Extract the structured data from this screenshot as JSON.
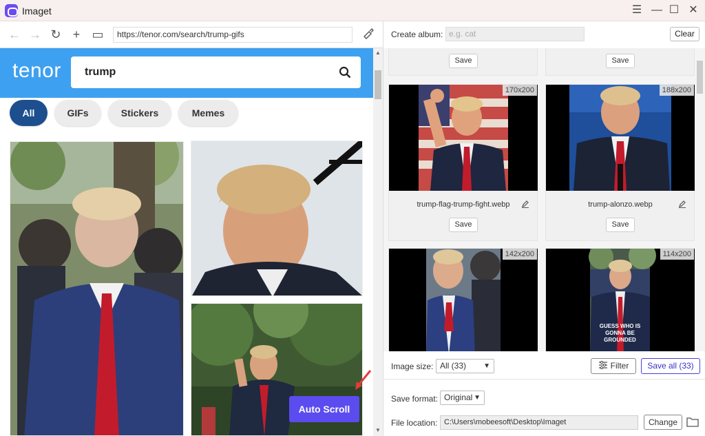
{
  "window": {
    "title": "Imaget"
  },
  "browser": {
    "url": "https://tenor.com/search/trump-gifs"
  },
  "tenor": {
    "logo": "tenor",
    "search_value": "trump",
    "chips": [
      "All",
      "GIFs",
      "Stickers",
      "Memes"
    ],
    "auto_scroll_label": "Auto Scroll"
  },
  "panel": {
    "create_album_label": "Create album:",
    "album_placeholder": "e.g. cat",
    "clear_label": "Clear",
    "save_label": "Save",
    "cards": [
      {
        "dims": "170x200",
        "filename": "trump-flag-trump-fight.webp"
      },
      {
        "dims": "188x200",
        "filename": "trump-alonzo.webp"
      },
      {
        "dims": "142x200",
        "filename": ""
      },
      {
        "dims": "114x200",
        "filename": ""
      }
    ],
    "image_size_label": "Image size:",
    "image_size_value": "All (33)",
    "filter_label": "Filter",
    "save_all_label": "Save all (33)",
    "save_format_label": "Save format:",
    "save_format_value": "Original",
    "file_location_label": "File location:",
    "file_location_value": "C:\\Users\\mobeesoft\\Desktop\\Imaget",
    "change_label": "Change",
    "card4_caption": "GUESS WHO IS GONNA BE GROUNDED"
  },
  "colors": {
    "accent": "#5b4cf0",
    "tenor_blue": "#3ea0f0",
    "chip_active": "#1d4f8f"
  }
}
